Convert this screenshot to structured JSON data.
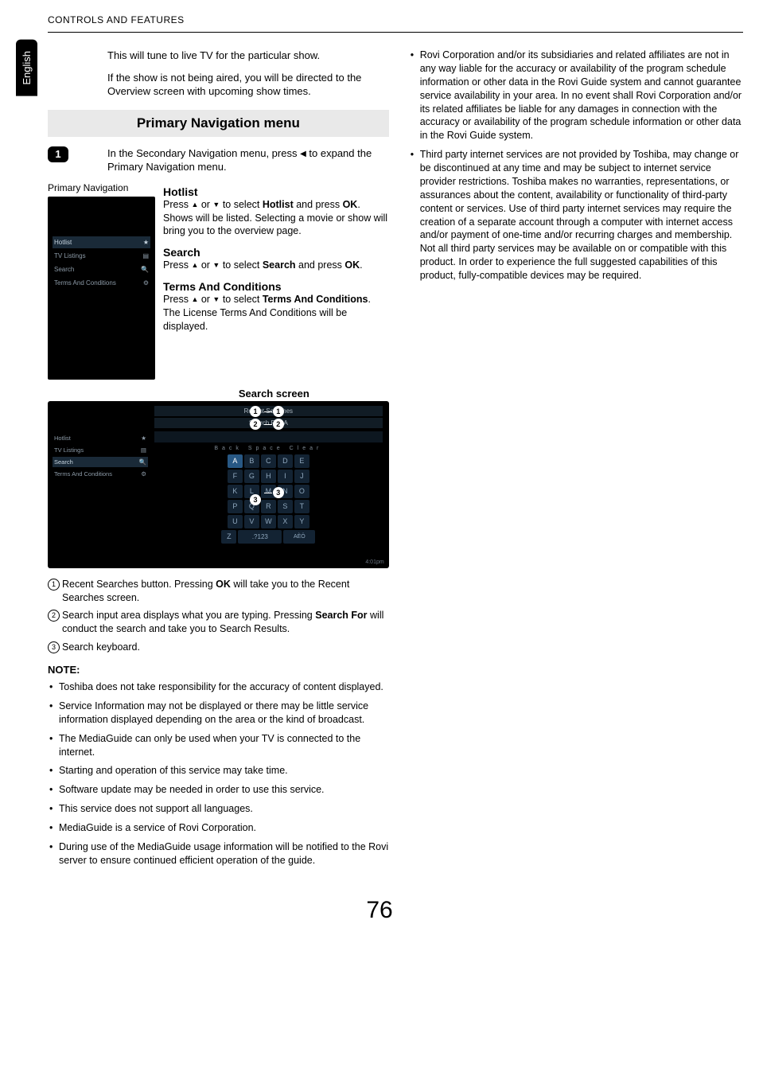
{
  "header": {
    "title": "CONTROLS AND FEATURES"
  },
  "language_tab": "English",
  "page_number": "76",
  "intro": {
    "p1": "This will tune to live TV for the particular show.",
    "p2": "If the show is not being aired, you will be directed to the Overview screen with upcoming show times."
  },
  "section_title": "Primary Navigation menu",
  "step1": {
    "pre": "In the Secondary Navigation menu, press ",
    "post": " to expand the Primary Navigation menu."
  },
  "primary_nav_label": "Primary Navigation",
  "nav_items": [
    {
      "label": "Hotlist",
      "icon": "star-icon"
    },
    {
      "label": "TV Listings",
      "icon": "schedule-icon"
    },
    {
      "label": "Search",
      "icon": "search-icon"
    },
    {
      "label": "Terms And Conditions",
      "icon": "settings-icon"
    }
  ],
  "menus": {
    "hotlist": {
      "title": "Hotlist",
      "body_1": "Press ",
      "body_2": " or ",
      "body_3": " to select ",
      "body_bold": "Hotlist",
      "body_4": " and press ",
      "ok": "OK",
      "body_5": ". Shows will be listed. Selecting a movie or show will bring you to the overview page."
    },
    "search": {
      "title": "Search",
      "body_1": "Press ",
      "body_2": " or ",
      "body_3": " to select ",
      "body_bold": "Search",
      "body_4": " and press ",
      "ok": "OK",
      "body_5": "."
    },
    "terms": {
      "title": "Terms And Conditions",
      "body_1": "Press ",
      "body_2": " or ",
      "body_3": " to select ",
      "body_bold": "Terms And Conditions",
      "body_4": ".",
      "body_5": "The License Terms And Conditions will be displayed."
    }
  },
  "search_screen_caption": "Search screen",
  "search_fig": {
    "recent": "Recent Searches",
    "search_for": "Search For: A",
    "back": "Back",
    "space": "Space",
    "clear": "Clear",
    "time": "4:01pm",
    "keys": [
      [
        "A",
        "B",
        "C",
        "D",
        "E"
      ],
      [
        "F",
        "G",
        "H",
        "I",
        "J"
      ],
      [
        "K",
        "L",
        "M",
        "N",
        "O"
      ],
      [
        "P",
        "Q",
        "R",
        "S",
        "T"
      ],
      [
        "U",
        "V",
        "W",
        "X",
        "Y"
      ]
    ],
    "bottom_row": {
      "z": "Z",
      "num": ".?123",
      "accent": "AÈÖ"
    }
  },
  "enum": {
    "e1_a": "Recent Searches button. Pressing ",
    "e1_ok": "OK",
    "e1_b": " will take you to the Recent Searches screen.",
    "e2_a": "Search input area displays what you are typing. Pressing ",
    "e2_bold": "Search For",
    "e2_b": " will conduct the search and take you to Search Results.",
    "e3": "Search keyboard."
  },
  "note_head": "NOTE:",
  "notes_left": [
    "Toshiba does not take responsibility for the accuracy of content displayed.",
    "Service Information may not be displayed or there may be little service information displayed depending on the area or the kind of broadcast.",
    "The MediaGuide can only be used when your TV is connected to the internet.",
    "Starting and operation of this service may take time.",
    "Software update may be needed in order to use this service.",
    "This service does not support all languages.",
    "MediaGuide is a service of Rovi Corporation.",
    "During use of the MediaGuide usage information will be notified to the Rovi server to ensure continued efficient operation of the guide."
  ],
  "notes_right": [
    "Rovi Corporation and/or its subsidiaries and related affiliates are not in any way liable for the accuracy or availability of the program schedule information or other data in the Rovi Guide system and cannot guarantee service availability in your area. In no event shall Rovi Corporation and/or its related affiliates be liable for any damages in connection with the accuracy or availability of the program schedule information or other data in the Rovi Guide system.",
    "Third party internet services are not provided by Toshiba, may change or be discontinued at any time and may be subject to internet service provider restrictions. Toshiba makes no warranties, representations, or assurances about the content, availability or functionality of third-party content or services. Use of third party internet services may require the creation of a separate account through a computer with internet access and/or payment of one-time and/or recurring charges and membership. Not all third party services may be available on or compatible with this product. In order to experience the full suggested capabilities of this product, fully-compatible devices may be required."
  ]
}
